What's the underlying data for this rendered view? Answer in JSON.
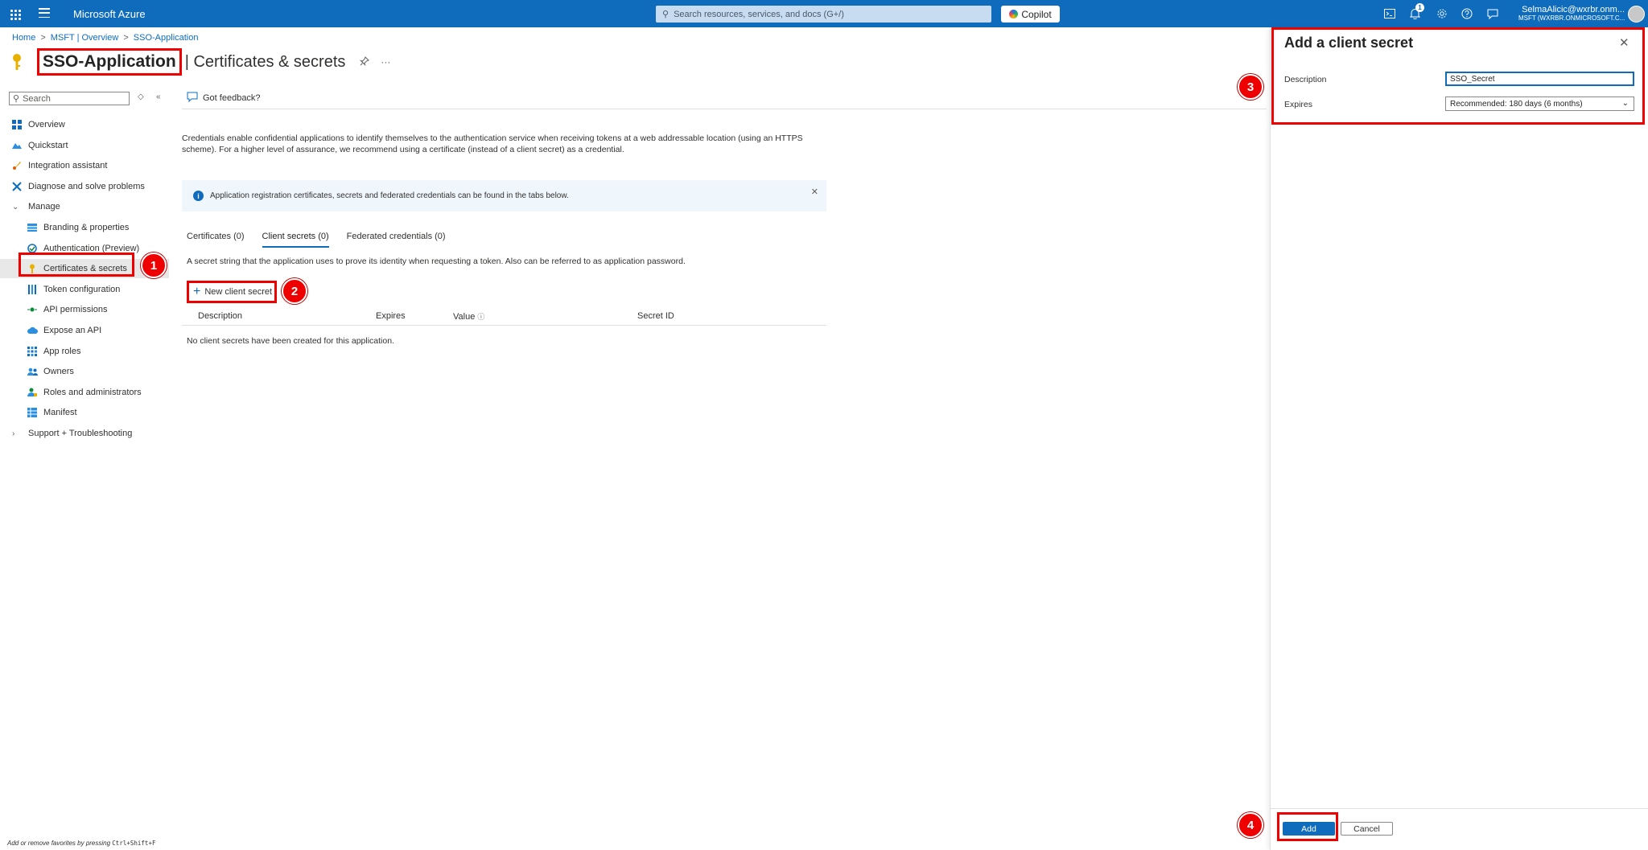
{
  "topbar": {
    "brand": "Microsoft Azure",
    "search_placeholder": "Search resources, services, and docs (G+/)",
    "copilot_label": "Copilot",
    "notification_count": "1",
    "user_name": "SelmaAlicic@wxrbr.onm...",
    "user_directory": "MSFT (WXRBR.ONMICROSOFT.C..."
  },
  "breadcrumb": {
    "items": [
      "Home",
      "MSFT | Overview",
      "SSO-Application"
    ],
    "separator": ">"
  },
  "page": {
    "title": "SSO-Application",
    "subtitle": "| Certificates & secrets",
    "more": "···"
  },
  "sidebar": {
    "search_placeholder": "Search",
    "items": [
      {
        "label": "Overview",
        "icon": "overview-icon"
      },
      {
        "label": "Quickstart",
        "icon": "quickstart-icon"
      },
      {
        "label": "Integration assistant",
        "icon": "rocket-icon"
      },
      {
        "label": "Diagnose and solve problems",
        "icon": "wrench-icon"
      },
      {
        "label": "Manage",
        "icon": "chevron-down-icon"
      },
      {
        "label": "Branding & properties",
        "icon": "branding-icon"
      },
      {
        "label": "Authentication (Preview)",
        "icon": "authentication-icon"
      },
      {
        "label": "Certificates & secrets",
        "icon": "key-icon"
      },
      {
        "label": "Token configuration",
        "icon": "token-icon"
      },
      {
        "label": "API permissions",
        "icon": "api-permissions-icon"
      },
      {
        "label": "Expose an API",
        "icon": "cloud-icon"
      },
      {
        "label": "App roles",
        "icon": "app-roles-icon"
      },
      {
        "label": "Owners",
        "icon": "owners-icon"
      },
      {
        "label": "Roles and administrators",
        "icon": "roles-icon"
      },
      {
        "label": "Manifest",
        "icon": "manifest-icon"
      },
      {
        "label": "Support + Troubleshooting",
        "icon": "chevron-right-icon"
      }
    ]
  },
  "main": {
    "feedback_label": "Got feedback?",
    "description": "Credentials enable confidential applications to identify themselves to the authentication service when receiving tokens at a web addressable location (using an HTTPS scheme). For a higher level of assurance, we recommend using a certificate (instead of a client secret) as a credential.",
    "info_message": "Application registration certificates, secrets and federated credentials can be found in the tabs below.",
    "tabs": [
      {
        "label": "Certificates (0)"
      },
      {
        "label": "Client secrets (0)"
      },
      {
        "label": "Federated credentials (0)"
      }
    ],
    "secret_description": "A secret string that the application uses to prove its identity when requesting a token. Also can be referred to as application password.",
    "new_secret_label": "New client secret",
    "table_headers": [
      "Description",
      "Expires",
      "Value",
      "Secret ID"
    ],
    "empty_message": "No client secrets have been created for this application."
  },
  "panel": {
    "title": "Add a client secret",
    "description_label": "Description",
    "description_value": "SSO_Secret",
    "expires_label": "Expires",
    "expires_value": "Recommended: 180 days (6 months)",
    "add_label": "Add",
    "cancel_label": "Cancel"
  },
  "annotations": {
    "steps": [
      "1",
      "2",
      "3",
      "4"
    ],
    "color": "#e00000"
  },
  "footer": {
    "hint_prefix": "Add or remove favorites by pressing",
    "hint_keys": "Ctrl+Shift+F"
  },
  "colors": {
    "accent": "#0f6cbd",
    "annotation": "#e00000"
  }
}
